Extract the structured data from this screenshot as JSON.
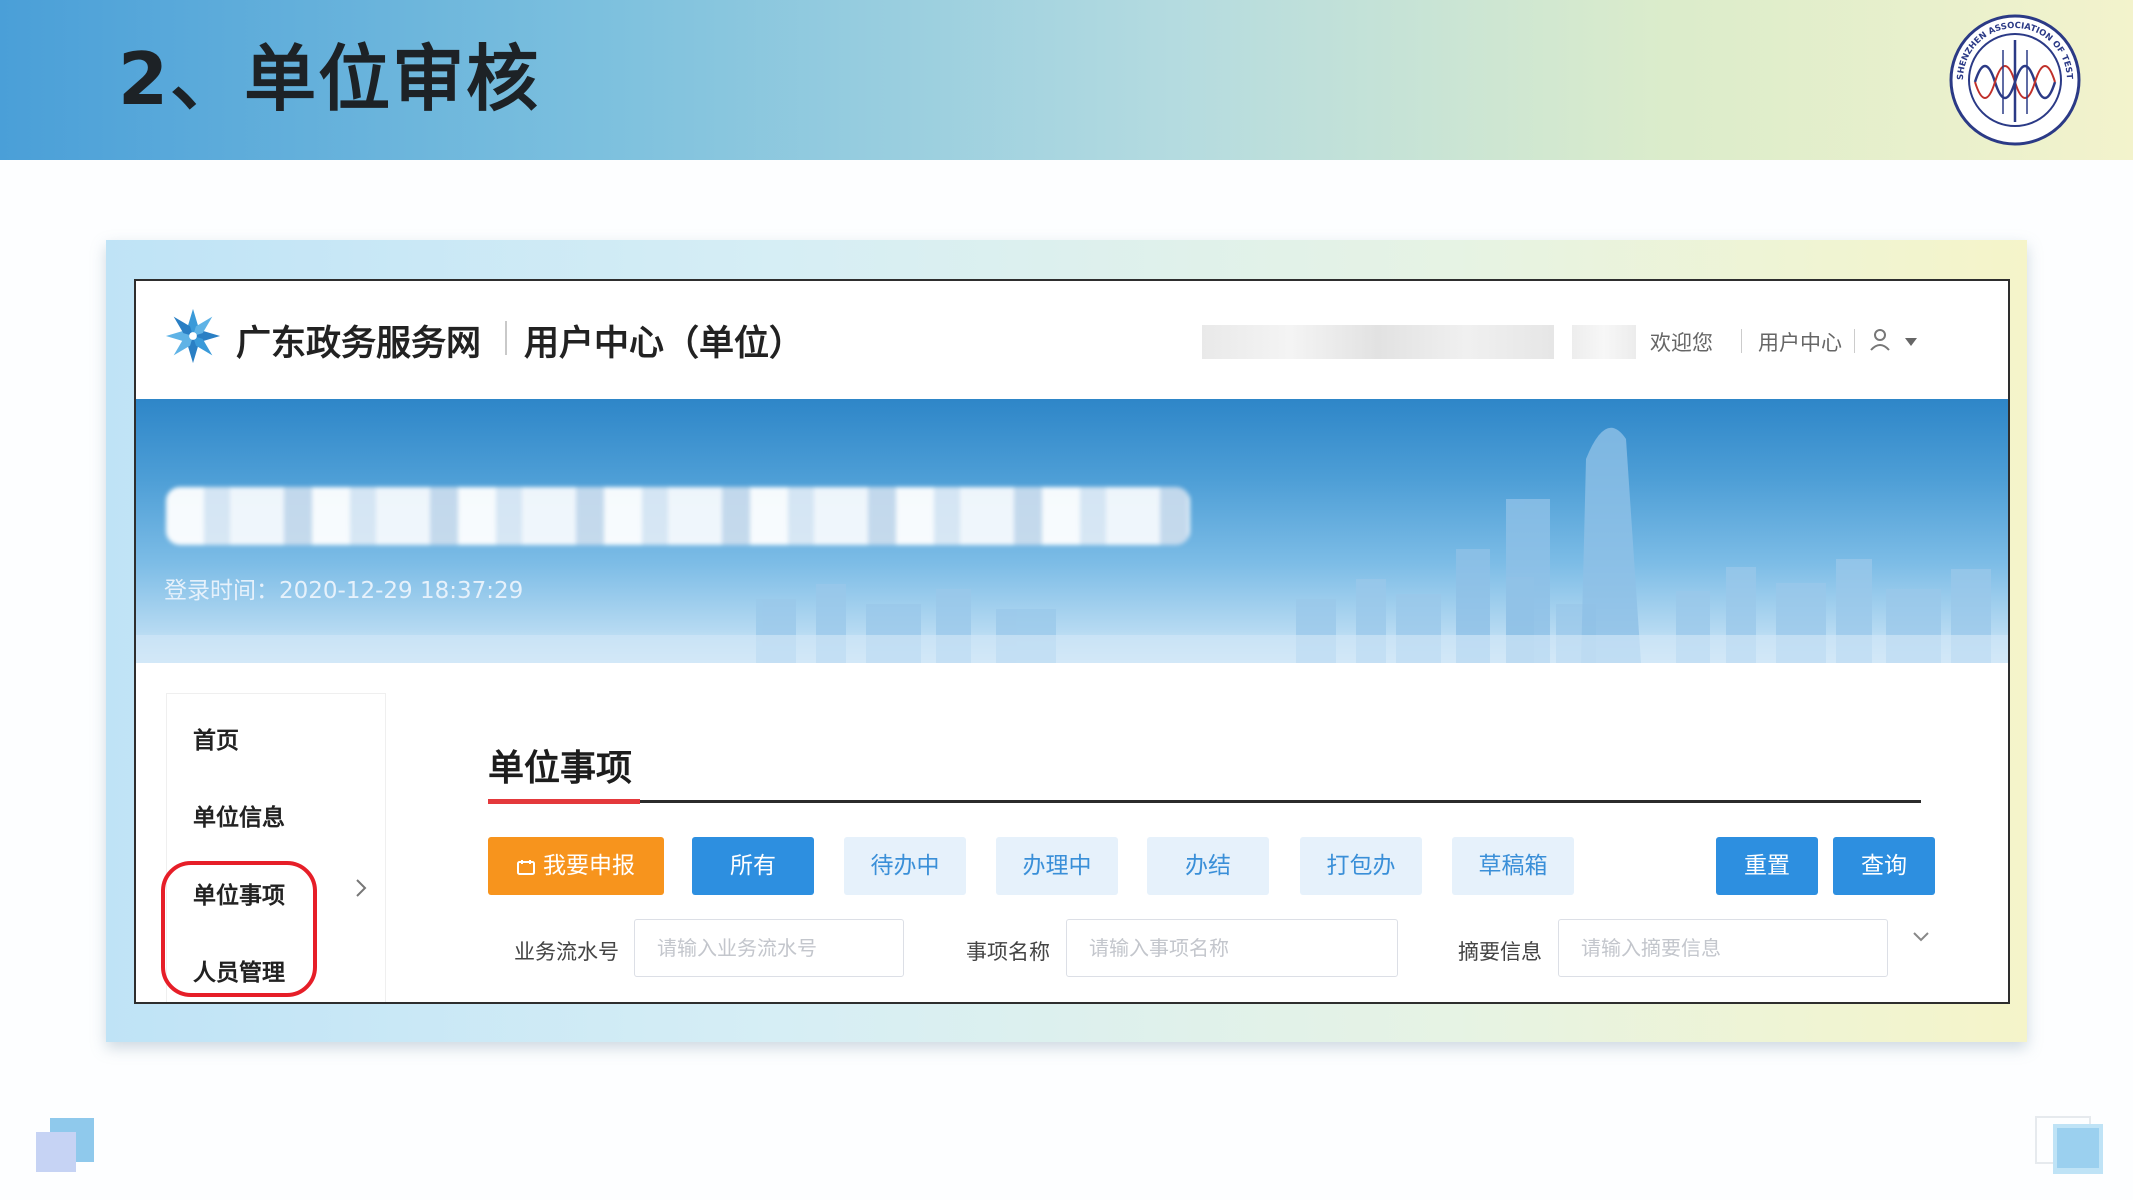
{
  "slide": {
    "title": "2、单位审核",
    "logo_icon": "sata-association-seal-icon",
    "logo_text": "SHENZHEN ASSOCIATION OF TESTERS AND ANALYSIS · S · A · T · A ·"
  },
  "portal": {
    "site_name": "广东政务服务网",
    "site_sub": "用户中心（单位）",
    "logo_icon": "snowflake-logo-icon",
    "welcome": "欢迎您",
    "user_center_link": "用户中心",
    "user_icon": "person-icon",
    "dropdown_icon": "caret-down-icon",
    "login_time": "登录时间：2020-12-29 18:37:29"
  },
  "sidebar": {
    "items": [
      {
        "label": "首页"
      },
      {
        "label": "单位信息"
      },
      {
        "label": "单位事项",
        "highlighted": true
      },
      {
        "label": "人员管理",
        "highlighted": true
      }
    ]
  },
  "content": {
    "section_title": "单位事项",
    "buttons": {
      "report": "我要申报",
      "all": "所有",
      "pending": "待办中",
      "processing": "办理中",
      "completed": "办结",
      "packaged": "打包办",
      "drafts": "草稿箱",
      "reset": "重置",
      "query": "查询"
    },
    "filters": [
      {
        "label": "业务流水号",
        "placeholder": "请输入业务流水号",
        "value": ""
      },
      {
        "label": "事项名称",
        "placeholder": "请输入事项名称",
        "value": ""
      },
      {
        "label": "摘要信息",
        "placeholder": "请输入摘要信息",
        "value": ""
      }
    ]
  },
  "colors": {
    "accent_blue": "#2d8fe0",
    "report_orange": "#f7941d",
    "tab_bg": "#e6f1fb",
    "highlight_red": "#e61e28",
    "section_underline_red": "#e4393c"
  }
}
